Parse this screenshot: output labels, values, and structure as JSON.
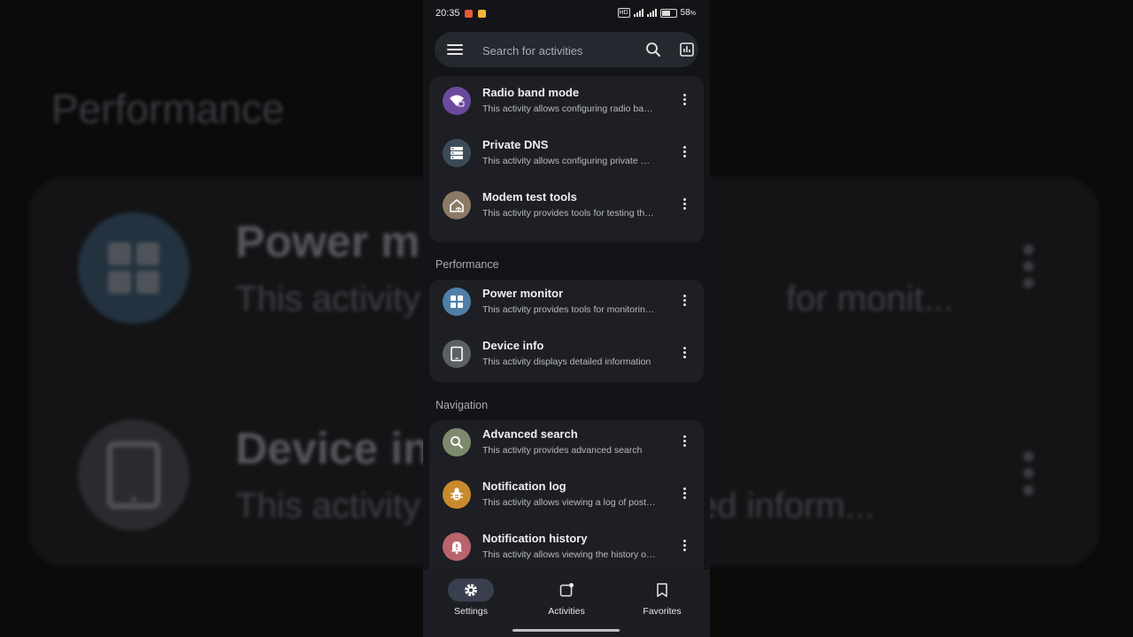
{
  "background": {
    "section_title": "Performance",
    "rows": [
      {
        "name": "Power m",
        "desc": "This activity",
        "desc_tail": "for monit...",
        "icon": "grid-icon",
        "color": "#23323f"
      },
      {
        "name": "Device in",
        "desc": "This activity",
        "desc_tail": "ed inform...",
        "icon": "tablet-icon",
        "color": "#2a2b2e"
      }
    ]
  },
  "statusbar": {
    "time": "20:35",
    "hd": "HD",
    "battery": "58"
  },
  "search": {
    "placeholder": "Search for activities"
  },
  "sections": [
    {
      "title": "",
      "items": [
        {
          "name": "Radio band mode",
          "desc": "This activity allows configuring radio band mode",
          "icon": "wifi-lock-icon",
          "color": "#6a4a9c"
        },
        {
          "name": "Private DNS",
          "desc": "This activity allows configuring private DNS",
          "icon": "dns-icon",
          "color": "#3b4c58"
        },
        {
          "name": "Modem test tools",
          "desc": "This activity provides tools for testing the modem",
          "icon": "home-signal-icon",
          "color": "#8b7b66"
        }
      ]
    },
    {
      "title": "Performance",
      "items": [
        {
          "name": "Power monitor",
          "desc": "This activity provides tools for monitoring power",
          "icon": "grid-icon",
          "color": "#4f7fa9"
        },
        {
          "name": "Device info",
          "desc": "This activity displays detailed information",
          "icon": "tablet-icon",
          "color": "#5c5f66"
        }
      ]
    },
    {
      "title": "Navigation",
      "items": [
        {
          "name": "Advanced search",
          "desc": "This activity provides advanced search",
          "icon": "search-icon",
          "color": "#7e8a6e"
        },
        {
          "name": "Notification log",
          "desc": "This activity allows viewing a log of posted notifications",
          "icon": "bug-icon",
          "color": "#c98a2e"
        },
        {
          "name": "Notification history",
          "desc": "This activity allows viewing the history of notifications",
          "icon": "bell-alert-icon",
          "color": "#b9636c"
        }
      ]
    }
  ],
  "bottom_nav": [
    {
      "label": "Settings",
      "icon": "gear-icon",
      "active": true
    },
    {
      "label": "Activities",
      "icon": "activities-icon",
      "active": false
    },
    {
      "label": "Favorites",
      "icon": "bookmark-icon",
      "active": false
    }
  ]
}
